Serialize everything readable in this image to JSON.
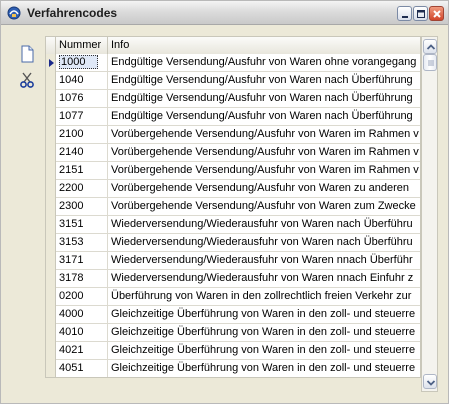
{
  "window": {
    "title": "Verfahrencodes"
  },
  "toolbar": {
    "new_icon": "new-document-icon",
    "cut_icon": "scissors-icon"
  },
  "grid": {
    "columns": [
      "Nummer",
      "Info"
    ],
    "selected_index": 0,
    "rows": [
      {
        "num": "1000",
        "info": "Endgültige Versendung/Ausfuhr von Waren ohne vorangegang"
      },
      {
        "num": "1040",
        "info": "Endgültige Versendung/Ausfuhr von Waren nach Überführung"
      },
      {
        "num": "1076",
        "info": "Endgültige Versendung/Ausfuhr von Waren nach Überführung"
      },
      {
        "num": "1077",
        "info": "Endgültige Versendung/Ausfuhr von Waren nach Überführung"
      },
      {
        "num": "2100",
        "info": "Vorübergehende Versendung/Ausfuhr von Waren im Rahmen v"
      },
      {
        "num": "2140",
        "info": "Vorübergehende Versendung/Ausfuhr von Waren im Rahmen v"
      },
      {
        "num": "2151",
        "info": "Vorübergehende Versendung/Ausfuhr von Waren im Rahmen v"
      },
      {
        "num": "2200",
        "info": "Vorübergehende Versendung/Ausfuhr von Waren zu anderen"
      },
      {
        "num": "2300",
        "info": "Vorübergehende Versendung/Ausfuhr von Waren zum Zwecke"
      },
      {
        "num": "3151",
        "info": "Wiederversendung/Wiederausfuhr von Waren nach Überführu"
      },
      {
        "num": "3153",
        "info": "Wiederversendung/Wiederausfuhr von Waren nach Überführu"
      },
      {
        "num": "3171",
        "info": "Wiederversendung/Wiederausfuhr von Waren nnach Überführ"
      },
      {
        "num": "3178",
        "info": "Wiederversendung/Wiederausfuhr von Waren nnach Einfuhr z"
      },
      {
        "num": "0200",
        "info": "Überführung von Waren in den zollrechtlich freien Verkehr zur"
      },
      {
        "num": "4000",
        "info": "Gleichzeitige Überführung von Waren in den zoll- und steuerre"
      },
      {
        "num": "4010",
        "info": "Gleichzeitige Überführung von Waren in den zoll- und steuerre"
      },
      {
        "num": "4021",
        "info": "Gleichzeitige Überführung von Waren in den zoll- und steuerre"
      },
      {
        "num": "4051",
        "info": "Gleichzeitige Überführung von Waren in den zoll- und steuerre"
      }
    ]
  },
  "colors": {
    "selection_arrow": "#1b2a8a",
    "close_button": "#d1452a"
  }
}
